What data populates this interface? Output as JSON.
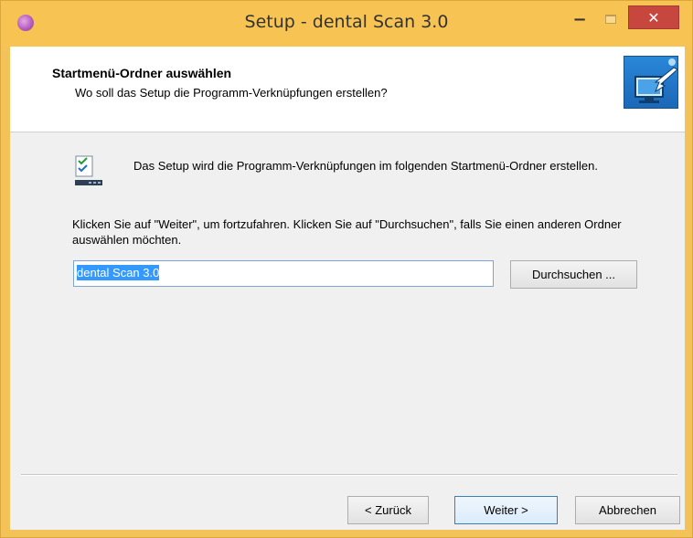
{
  "window": {
    "title": "Setup - dental Scan 3.0",
    "minimize_label": "−",
    "close_label": "✕"
  },
  "header": {
    "title": "Startmenü-Ordner auswählen",
    "subtitle": "Wo soll das Setup die Programm-Verknüpfungen erstellen?"
  },
  "body": {
    "intro_text": "Das Setup wird die Programm-Verknüpfungen im folgenden Startmenü-Ordner erstellen.",
    "instruction_text": "Klicken Sie auf \"Weiter\", um fortzufahren. Klicken Sie auf \"Durchsuchen\", falls Sie einen anderen Ordner auswählen möchten.",
    "folder_value": "dental Scan 3.0",
    "browse_label": "Durchsuchen ..."
  },
  "footer": {
    "back_label": "< Zurück",
    "next_label": "Weiter >",
    "cancel_label": "Abbrechen"
  },
  "icons": {
    "app": "app-icon",
    "wizard": "computer-arrow-icon",
    "info": "shortcut-list-icon"
  },
  "colors": {
    "title_bar": "#f7c453",
    "close_button": "#c7463d",
    "selection": "#3399ff"
  }
}
